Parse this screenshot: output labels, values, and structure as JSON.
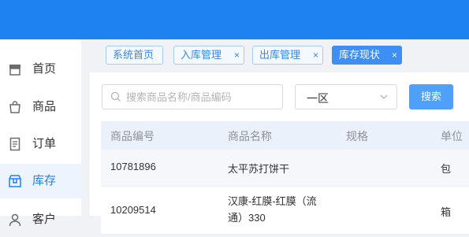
{
  "sidebar": {
    "items": [
      {
        "label": "首页",
        "icon": "store-icon"
      },
      {
        "label": "商品",
        "icon": "bag-icon"
      },
      {
        "label": "订单",
        "icon": "document-icon"
      },
      {
        "label": "库存",
        "icon": "box-icon",
        "active": true
      },
      {
        "label": "客户",
        "icon": "user-icon"
      }
    ]
  },
  "tabs": [
    {
      "label": "系统首页",
      "closable": false
    },
    {
      "label": "入库管理",
      "closable": true
    },
    {
      "label": "出库管理",
      "closable": true
    },
    {
      "label": "库存现状",
      "closable": true,
      "active": true
    }
  ],
  "tab_close_glyph": "×",
  "filters": {
    "search_placeholder": "搜索商品名称/商品编码",
    "search_value": "",
    "zone_selected": "一区",
    "search_button": "搜索"
  },
  "table": {
    "columns": [
      "商品编号",
      "商品名称",
      "规格",
      "单位"
    ],
    "rows": [
      {
        "code": "10781896",
        "name": "太平苏打饼干",
        "spec": "",
        "unit": "包"
      },
      {
        "code": "10209514",
        "name_line1": "汉康-红膜-红膜（流",
        "name_line2": "通）330",
        "spec": "",
        "unit": "箱"
      }
    ]
  },
  "colors": {
    "accent": "#1e82f0",
    "button": "#4ea0f8",
    "active_tab": "#3d8ff5"
  }
}
